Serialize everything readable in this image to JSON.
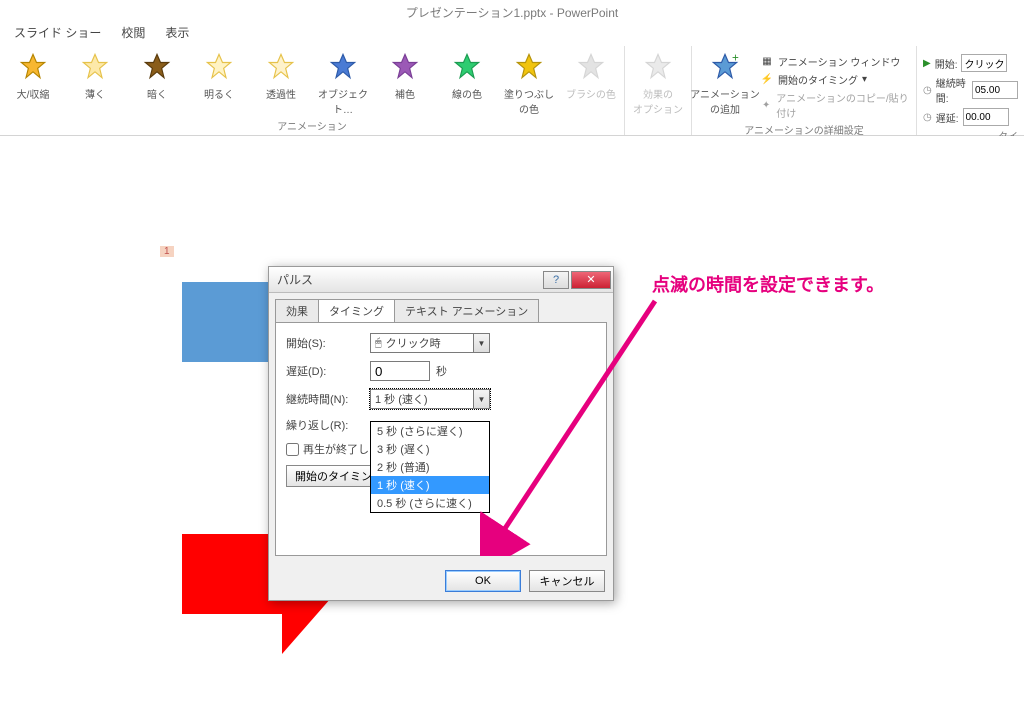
{
  "app": {
    "title": "プレゼンテーション1.pptx - PowerPoint"
  },
  "tabs": {
    "t1": "スライド ショー",
    "t2": "校閲",
    "t3": "表示"
  },
  "ribbon": {
    "anim_items": [
      {
        "label": "大/収縮"
      },
      {
        "label": "薄く"
      },
      {
        "label": "暗く"
      },
      {
        "label": "明るく"
      },
      {
        "label": "透過性"
      },
      {
        "label": "オブジェクト…"
      },
      {
        "label": "補色"
      },
      {
        "label": "線の色"
      },
      {
        "label": "塗りつぶしの色"
      },
      {
        "label": "ブラシの色"
      }
    ],
    "anim_caption": "アニメーション",
    "opts": "効果の\nオプション",
    "add": "アニメーション\nの追加",
    "adv": {
      "pane": "アニメーション ウィンドウ",
      "trigger": "開始のタイミング",
      "painter": "アニメーションのコピー/貼り付け",
      "caption": "アニメーションの詳細設定"
    },
    "timing": {
      "start_lbl": "開始:",
      "start_val": "クリック時",
      "dur_lbl": "継続時間:",
      "dur_val": "05.00",
      "delay_lbl": "遅延:",
      "delay_val": "00.00",
      "caption": "タイ"
    }
  },
  "slide": {
    "num": "1"
  },
  "dialog": {
    "title": "パルス",
    "tabs": {
      "effect": "効果",
      "timing": "タイミング",
      "text": "テキスト アニメーション"
    },
    "fields": {
      "start_lbl": "開始(S):",
      "start_val": "クリック時",
      "delay_lbl": "遅延(D):",
      "delay_val": "0",
      "delay_unit": "秒",
      "dur_lbl": "継続時間(N):",
      "dur_val": "1 秒 (速く)",
      "repeat_lbl": "繰り返し(R):",
      "rewind_lbl": "再生が終了し",
      "trigger_btn": "開始のタイミング"
    },
    "dur_options": [
      "5 秒 (さらに遅く)",
      "3 秒 (遅く)",
      "2 秒 (普通)",
      "1 秒 (速く)",
      "0.5 秒 (さらに速く)"
    ],
    "ok": "OK",
    "cancel": "キャンセル"
  },
  "callout": "点滅の時間を設定できます。"
}
